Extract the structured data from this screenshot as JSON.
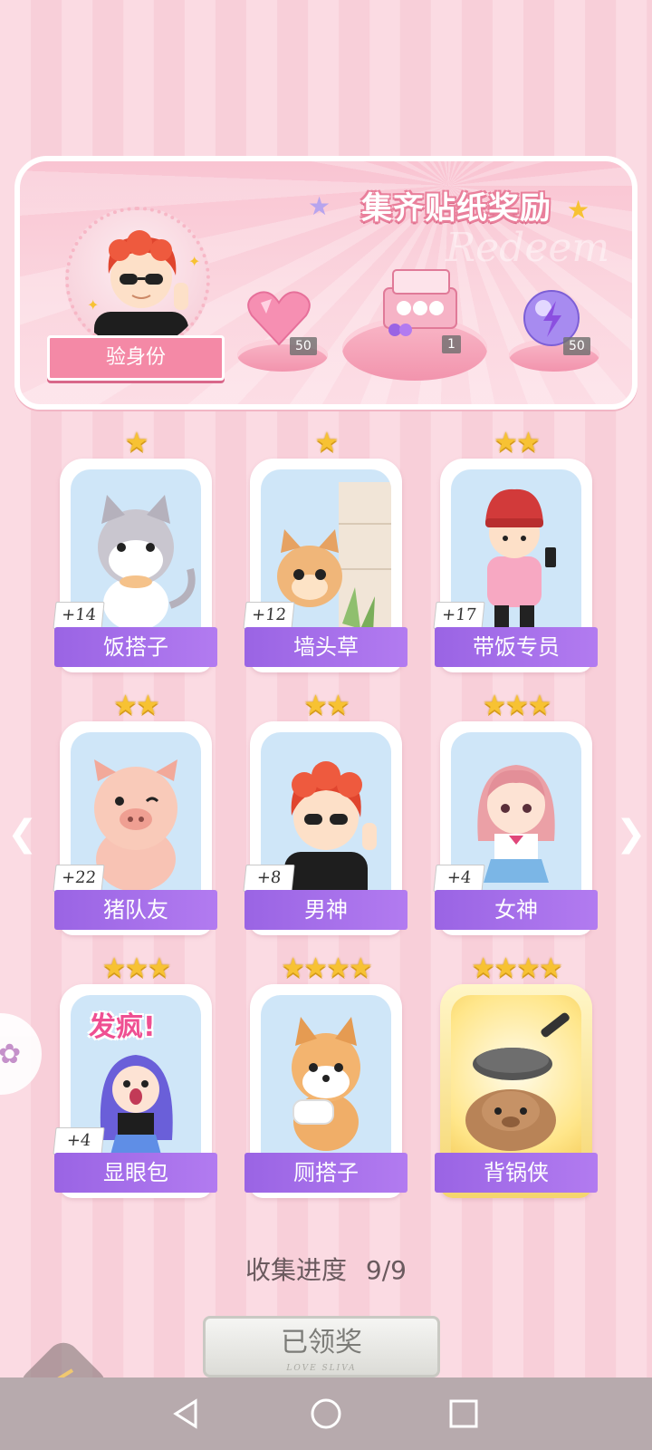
{
  "banner": {
    "title": "集齐贴纸奖励",
    "watermark": "Redeem",
    "verify_label": "验身份",
    "rewards": [
      {
        "icon": "heart-gem-icon",
        "count": "50"
      },
      {
        "icon": "gift-box-icon",
        "count": "1"
      },
      {
        "icon": "energy-orb-icon",
        "count": "50"
      }
    ]
  },
  "stickers": [
    {
      "name": "饭搭子",
      "plus": "+14",
      "stars": "★",
      "art": "cat-icon"
    },
    {
      "name": "墙头草",
      "plus": "+12",
      "stars": "★",
      "art": "squirrel-icon"
    },
    {
      "name": "带饭专员",
      "plus": "+17",
      "stars": "★★",
      "art": "girl-backpack-icon"
    },
    {
      "name": "猪队友",
      "plus": "+22",
      "stars": "★★",
      "art": "pig-icon"
    },
    {
      "name": "男神",
      "plus": "+8",
      "stars": "★★",
      "art": "boy-sunglasses-icon"
    },
    {
      "name": "女神",
      "plus": "+4",
      "stars": "★★★",
      "art": "girl-uniform-icon"
    },
    {
      "name": "显眼包",
      "plus": "+4",
      "stars": "★★★",
      "art": "crazy-girl-icon",
      "badge": "发疯!"
    },
    {
      "name": "厕搭子",
      "plus": "",
      "stars": "★★★★",
      "art": "shiba-icon"
    },
    {
      "name": "背锅侠",
      "plus": "",
      "stars": "★★★★",
      "art": "capybara-pan-icon"
    }
  ],
  "progress": {
    "label": "收集进度",
    "value": "9/9"
  },
  "claim": {
    "label": "已领奖",
    "sub": "LOVE SLIVA"
  },
  "colors": {
    "accent": "#9a64e4",
    "pink": "#f489a6",
    "star": "#f7c233"
  }
}
